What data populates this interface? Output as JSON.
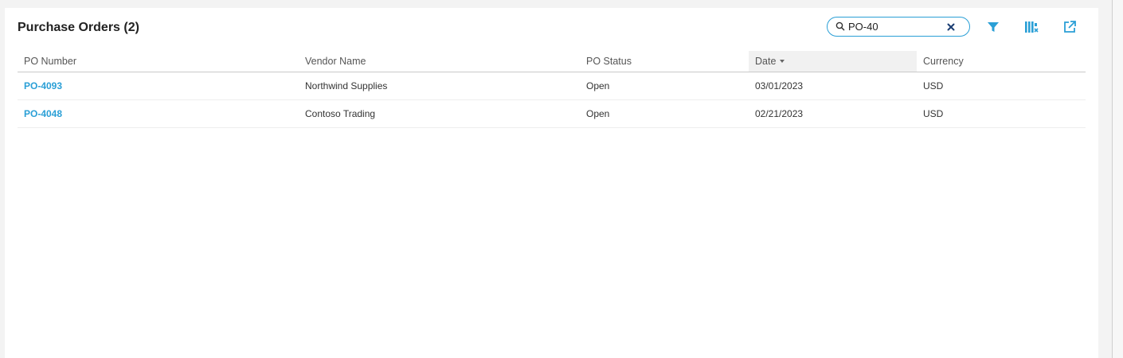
{
  "header": {
    "title": "Purchase Orders (2)"
  },
  "search": {
    "value": "PO-40",
    "icon": "search-icon",
    "clear_icon": "close-icon"
  },
  "toolbar": {
    "icons": [
      "filter-icon",
      "columns-settings-icon",
      "export-icon"
    ]
  },
  "table": {
    "columns": [
      "PO Number",
      "Vendor Name",
      "PO Status",
      "Date",
      "Currency"
    ],
    "sorted_column": "Date",
    "sort_direction": "descending",
    "rows": [
      {
        "po_number": "PO-4093",
        "vendor": "Northwind Supplies",
        "status": "Open",
        "date": "03/01/2023",
        "currency": "USD"
      },
      {
        "po_number": "PO-4048",
        "vendor": "Contoso Trading",
        "status": "Open",
        "date": "02/21/2023",
        "currency": "USD"
      }
    ]
  },
  "colors": {
    "accent": "#2a9fd6",
    "text": "#333333",
    "background": "#ffffff"
  }
}
